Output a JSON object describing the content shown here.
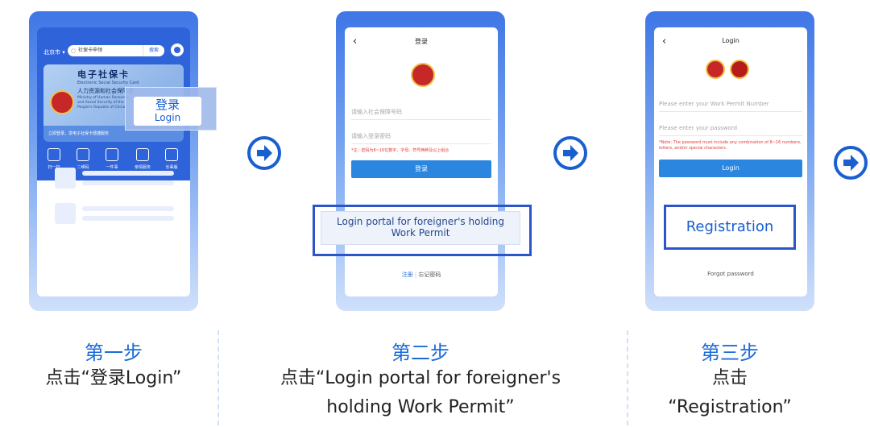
{
  "colors": {
    "primary_blue": "#1a6cd8",
    "button_blue": "#2b86e0",
    "frame_blue": "#3f76e6",
    "highlight_border": "#2b55c9",
    "error_red": "#e53935"
  },
  "screen1": {
    "city": "北京市 ▾",
    "search_placeholder": "社保卡申领",
    "search_button": "搜索",
    "card_title": "电子社保卡",
    "card_subtitle": "Electronic Social Security Card",
    "card_dept": "人力资源和社会保障部",
    "card_ministry": "Ministry of Human Resources and Social Security of the People's Republic of China",
    "card_bar": "立即登录，享电子社保卡便捷服务",
    "callout_cn": "登录",
    "callout_en": "Login",
    "icons": [
      "扫一扫",
      "二维码",
      "一件事",
      "亲情服务",
      "长辈版"
    ]
  },
  "screen2": {
    "title": "登录",
    "field_ssn": "请输入社会保障号码",
    "field_pwd": "请输入登录密码",
    "note": "*注：密码为8~16位数字、字母、符号两种及以上组合",
    "login_button": "登录",
    "portal_line1": "Login portal for foreigner's holding",
    "portal_line2": "Work Permit",
    "register": "注册",
    "separator": "|",
    "forgot": "忘记密码"
  },
  "screen3": {
    "title": "Login",
    "field_permit": "Please enter your Work Permit Number",
    "field_pwd": "Please enter your password",
    "note": "*Note: The password must include any combination of 8~16 numbers, letters, and/or special characters.",
    "login_button": "Login",
    "registration": "Registration",
    "forgot": "Forgot password"
  },
  "steps": [
    {
      "label": "第一步",
      "line1": "点击“登录Login”",
      "line2": ""
    },
    {
      "label": "第二步",
      "line1": "点击“Login portal for foreigner's",
      "line2": "holding Work Permit”"
    },
    {
      "label": "第三步",
      "line1": "点击",
      "line2": "“Registration”"
    }
  ],
  "icons": {
    "next_arrow": "arrow-right-circle-icon"
  }
}
